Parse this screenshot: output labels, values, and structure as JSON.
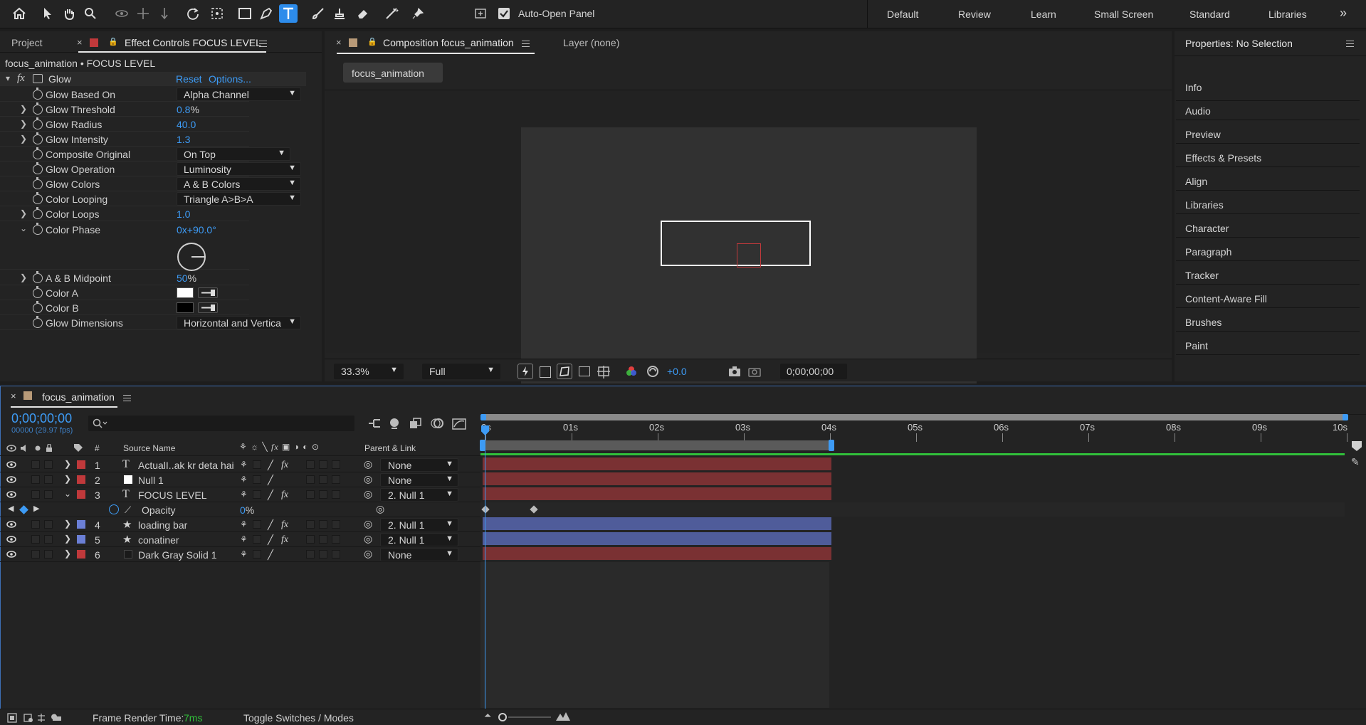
{
  "toolbar": {
    "auto_open_panel": "Auto-Open Panel",
    "workspaces": [
      "Default",
      "Review",
      "Learn",
      "Small Screen",
      "Standard",
      "Libraries"
    ],
    "more": "»"
  },
  "left_panel": {
    "tab_project": "Project",
    "tab_effect_controls": "Effect Controls FOCUS LEVEL",
    "breadcrumb": "focus_animation • FOCUS LEVEL",
    "effect_name": "Glow",
    "reset": "Reset",
    "options": "Options...",
    "props": [
      {
        "label": "Glow Based On",
        "kind": "dropdown",
        "value": "Alpha Channel"
      },
      {
        "label": "Glow Threshold",
        "kind": "value",
        "value": "0.8",
        "unit": "%"
      },
      {
        "label": "Glow Radius",
        "kind": "value",
        "value": "40.0",
        "unit": ""
      },
      {
        "label": "Glow Intensity",
        "kind": "value",
        "value": "1.3",
        "unit": ""
      },
      {
        "label": "Composite Original",
        "kind": "dropdown",
        "value": "On Top"
      },
      {
        "label": "Glow Operation",
        "kind": "dropdown",
        "value": "Luminosity"
      },
      {
        "label": "Glow Colors",
        "kind": "dropdown",
        "value": "A & B Colors"
      },
      {
        "label": "Color Looping",
        "kind": "dropdown",
        "value": "Triangle A>B>A"
      },
      {
        "label": "Color Loops",
        "kind": "value",
        "value": "1.0",
        "unit": ""
      },
      {
        "label": "Color Phase",
        "kind": "value",
        "value": "0x+90.0°",
        "unit": ""
      },
      {
        "label": "A & B Midpoint",
        "kind": "value",
        "value": "50",
        "unit": "%"
      },
      {
        "label": "Color A",
        "kind": "color",
        "value": "#ffffff"
      },
      {
        "label": "Color B",
        "kind": "color",
        "value": "#000000"
      },
      {
        "label": "Glow Dimensions",
        "kind": "dropdown",
        "value": "Horizontal and Vertica"
      }
    ]
  },
  "comp_panel": {
    "tab_composition": "Composition focus_animation",
    "tab_layer": "Layer (none)",
    "comp_chip": "focus_animation",
    "zoom": "33.3%",
    "resolution": "Full",
    "exposure": "+0.0",
    "timecode": "0;00;00;00"
  },
  "properties_panel": {
    "title": "Properties: No Selection",
    "items": [
      "Info",
      "Audio",
      "Preview",
      "Effects & Presets",
      "Align",
      "Libraries",
      "Character",
      "Paragraph",
      "Tracker",
      "Content-Aware Fill",
      "Brushes",
      "Paint"
    ]
  },
  "timeline": {
    "tab": "focus_animation",
    "timecode": "0;00;00;00",
    "frame_info": "00000 (29.97 fps)",
    "search_placeholder": "",
    "col_num": "#",
    "col_source": "Source Name",
    "col_parent": "Parent & Link",
    "ruler": [
      "0s",
      "01s",
      "02s",
      "03s",
      "04s",
      "05s",
      "06s",
      "07s",
      "08s",
      "09s",
      "10s"
    ],
    "layers": [
      {
        "num": "1",
        "name": "ActualI..ak kr deta hai",
        "type": "T",
        "color": "#c0393b",
        "parent": "None"
      },
      {
        "num": "2",
        "name": "Null 1",
        "type": "null",
        "color": "#c0393b",
        "parent": "None"
      },
      {
        "num": "3",
        "name": "FOCUS LEVEL",
        "type": "T",
        "color": "#c0393b",
        "parent": "2. Null 1"
      },
      {
        "num": "4",
        "name": "loading bar",
        "type": "star",
        "color": "#6b7fd6",
        "parent": "2. Null 1"
      },
      {
        "num": "5",
        "name": "conatiner",
        "type": "star",
        "color": "#6b7fd6",
        "parent": "2. Null 1"
      },
      {
        "num": "6",
        "name": "Dark Gray Solid 1",
        "type": "solid",
        "color": "#c0393b",
        "parent": "None"
      }
    ],
    "sub_property": {
      "name": "Opacity",
      "value": "0",
      "unit": "%"
    },
    "frame_render_label": "Frame Render Time:",
    "frame_render_value": "7ms",
    "toggle_label": "Toggle Switches / Modes"
  }
}
